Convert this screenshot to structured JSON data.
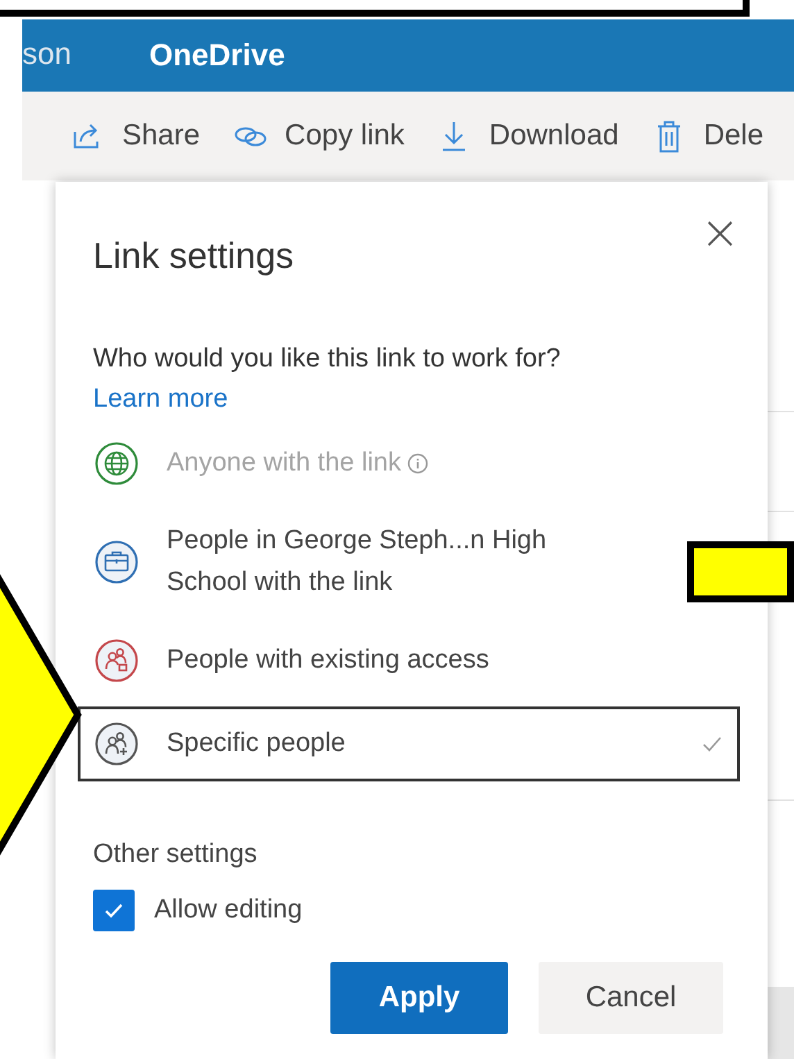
{
  "header": {
    "user_name_partial": "son",
    "app_name": "OneDrive"
  },
  "toolbar": [
    {
      "kind": "share",
      "label": "Share"
    },
    {
      "kind": "copy-link",
      "label": "Copy link"
    },
    {
      "kind": "download",
      "label": "Download"
    },
    {
      "kind": "delete",
      "label": "Dele"
    }
  ],
  "dialog": {
    "title": "Link settings",
    "close": "×",
    "question": "Who would you like this link to work for?",
    "learn_more": "Learn more",
    "options": [
      {
        "kind": "globe",
        "label": "Anyone with the link",
        "color": "#2e8b3a",
        "disabled": true,
        "info": true,
        "selected": false
      },
      {
        "kind": "organization",
        "label": "People in George Steph...n High School with the link",
        "color": "#2f6fb3",
        "disabled": false,
        "info": false,
        "selected": false
      },
      {
        "kind": "existing",
        "label": "People with existing access",
        "color": "#c4474b",
        "disabled": false,
        "info": false,
        "selected": false
      },
      {
        "kind": "specific",
        "label": "Specific people",
        "color": "#555555",
        "disabled": false,
        "info": false,
        "selected": true
      }
    ],
    "other_settings": "Other settings",
    "allow_editing": {
      "label": "Allow editing",
      "checked": true
    },
    "buttons": [
      {
        "kind": "primary",
        "label": "Apply"
      },
      {
        "kind": "secondary",
        "label": "Cancel"
      }
    ]
  }
}
